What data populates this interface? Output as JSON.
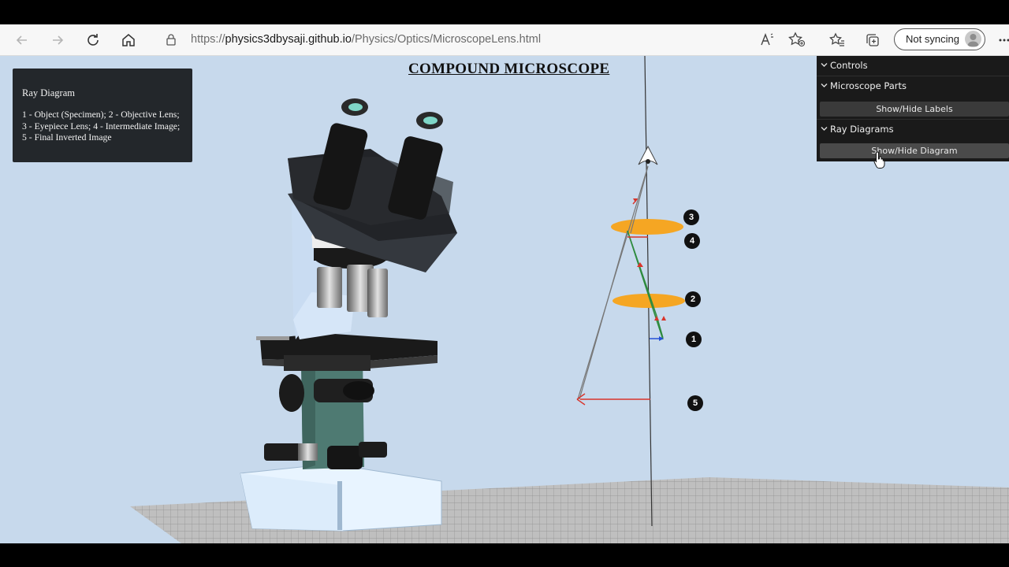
{
  "browser": {
    "url_prefix": "https://",
    "url_host": "physics3dbysaji.github.io",
    "url_path": "/Physics/Optics/MicroscopeLens.html",
    "sync_label": "Not syncing"
  },
  "page": {
    "title": "COMPOUND MICROSCOPE"
  },
  "info_panel": {
    "title": "Ray Diagram",
    "body": "1 - Object (Specimen); 2 - Objective Lens; 3 - Eyepiece Lens; 4 - Intermediate Image; 5 - Final Inverted Image"
  },
  "gui": {
    "root_label": "Controls",
    "folders": [
      {
        "label": "Microscope Parts",
        "button": "Show/Hide Labels"
      },
      {
        "label": "Ray Diagrams",
        "button": "Show/Hide Diagram"
      }
    ]
  },
  "diagram_labels": [
    "1",
    "2",
    "3",
    "4",
    "5"
  ],
  "colors": {
    "sky": "#c7d9ec",
    "lens": "#f5a623",
    "microscope_arm": "#c9dcf2",
    "microscope_base": "#4e7a72",
    "black": "#111111"
  }
}
